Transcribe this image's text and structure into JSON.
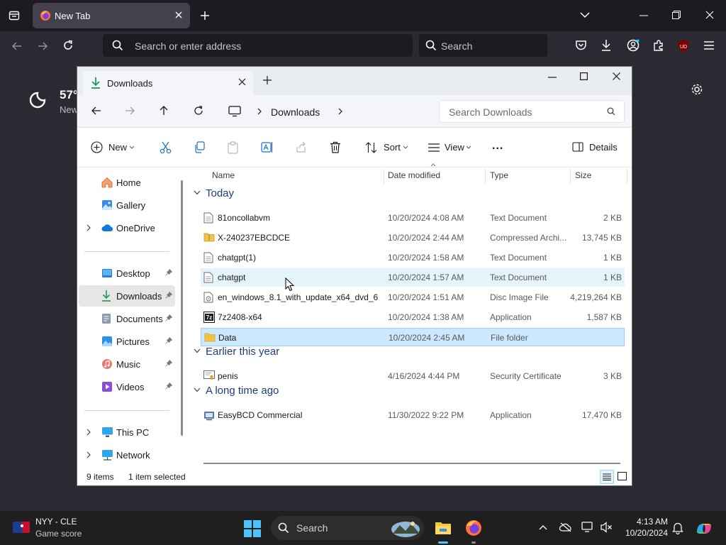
{
  "browser": {
    "tab_title": "New Tab",
    "address_placeholder": "Search or enter address",
    "search_placeholder": "Search",
    "weather_temp": "57°",
    "weather_location": "New",
    "ublock_badge": "UD"
  },
  "explorer": {
    "tab_title": "Downloads",
    "breadcrumb": "Downloads",
    "search_placeholder": "Search Downloads",
    "toolbar": {
      "new_label": "New",
      "sort_label": "Sort",
      "view_label": "View",
      "more_label": "...",
      "details_label": "Details"
    },
    "sidebar": {
      "home": "Home",
      "gallery": "Gallery",
      "onedrive": "OneDrive",
      "desktop": "Desktop",
      "downloads": "Downloads",
      "documents": "Documents",
      "pictures": "Pictures",
      "music": "Music",
      "videos": "Videos",
      "thispc": "This PC",
      "network": "Network"
    },
    "columns": {
      "name": "Name",
      "date": "Date modified",
      "type": "Type",
      "size": "Size"
    },
    "groups": {
      "today": "Today",
      "earlier": "Earlier this year",
      "longago": "A long time ago"
    },
    "files": [
      {
        "name": "81oncollabvm",
        "date": "10/20/2024 4:08 AM",
        "type": "Text Document",
        "size": "2 KB",
        "icon": "text-file-icon"
      },
      {
        "name": "X-240237EBCDCE",
        "date": "10/20/2024 2:44 AM",
        "type": "Compressed Archi...",
        "size": "13,745 KB",
        "icon": "zip-folder-icon"
      },
      {
        "name": "chatgpt(1)",
        "date": "10/20/2024 1:58 AM",
        "type": "Text Document",
        "size": "1 KB",
        "icon": "text-file-icon"
      },
      {
        "name": "chatgpt",
        "date": "10/20/2024 1:57 AM",
        "type": "Text Document",
        "size": "1 KB",
        "icon": "text-file-icon"
      },
      {
        "name": "en_windows_8.1_with_update_x64_dvd_6...",
        "date": "10/20/2024 1:51 AM",
        "type": "Disc Image File",
        "size": "4,219,264 KB",
        "icon": "disc-image-icon"
      },
      {
        "name": "7z2408-x64",
        "date": "10/20/2024 1:38 AM",
        "type": "Application",
        "size": "1,587 KB",
        "icon": "7zip-app-icon"
      },
      {
        "name": "Data",
        "date": "10/20/2024 2:45 AM",
        "type": "File folder",
        "size": "",
        "icon": "folder-icon"
      },
      {
        "name": "penis",
        "date": "4/16/2024 4:44 PM",
        "type": "Security Certificate",
        "size": "3 KB",
        "icon": "certificate-icon"
      },
      {
        "name": "EasyBCD Commercial",
        "date": "11/30/2022 9:22 PM",
        "type": "Application",
        "size": "17,470 KB",
        "icon": "installer-app-icon"
      }
    ],
    "status": {
      "items": "9 items",
      "selected": "1 item selected"
    }
  },
  "taskbar": {
    "weather_title": "NYY - CLE",
    "weather_sub": "Game score",
    "search_placeholder": "Search",
    "time": "4:13 AM",
    "date": "10/20/2024"
  },
  "colors": {
    "accent": "#0067c0",
    "selected_row": "#cce8ff",
    "hover_row": "#e5f3fb",
    "group_header": "#1f3d7a"
  }
}
